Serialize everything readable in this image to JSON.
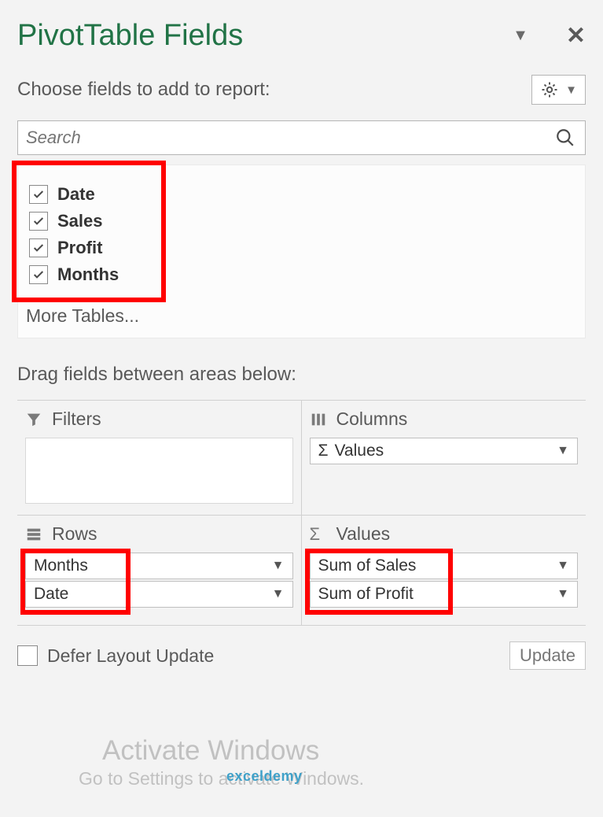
{
  "header": {
    "title": "PivotTable Fields"
  },
  "subheader": {
    "choose_label": "Choose fields to add to report:"
  },
  "search": {
    "placeholder": "Search"
  },
  "fields": [
    {
      "label": "Date",
      "checked": true
    },
    {
      "label": "Sales",
      "checked": true
    },
    {
      "label": "Profit",
      "checked": true
    },
    {
      "label": "Months",
      "checked": true
    }
  ],
  "more_tables_label": "More Tables...",
  "drag_label": "Drag fields between areas below:",
  "areas": {
    "filters": {
      "header": "Filters",
      "items": []
    },
    "columns": {
      "header": "Columns",
      "items": [
        "Values"
      ]
    },
    "rows": {
      "header": "Rows",
      "items": [
        "Months",
        "Date"
      ]
    },
    "values": {
      "header": "Values",
      "items": [
        "Sum of Sales",
        "Sum of Profit"
      ]
    }
  },
  "footer": {
    "defer_label": "Defer Layout Update",
    "update_label": "Update"
  },
  "watermark": {
    "line1": "Activate Windows",
    "line2": "Go to Settings to activate Windows.",
    "logo": "exceldemy"
  },
  "columns_sigma_label": "Σ"
}
